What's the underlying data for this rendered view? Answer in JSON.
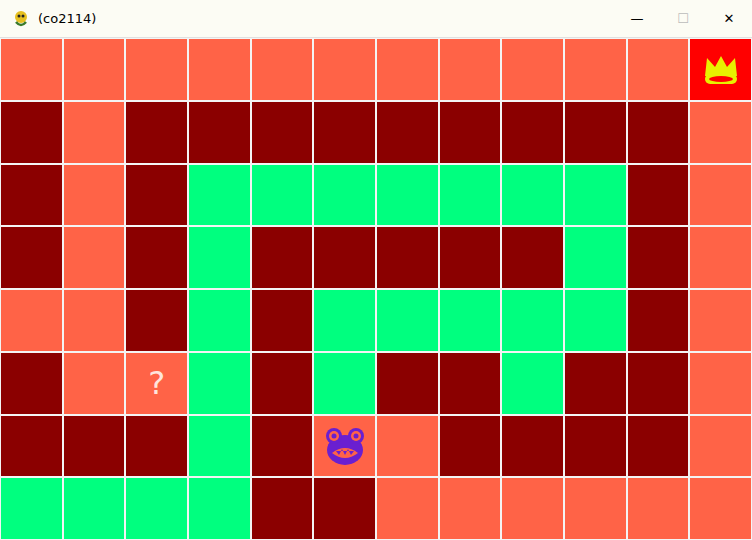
{
  "window": {
    "title": "(co2114)",
    "controls": [
      "—",
      "☐",
      "✕"
    ]
  },
  "grid": {
    "rows": [
      [
        {
          "kind": "plain",
          "color": "#ff6347"
        },
        {
          "kind": "plain",
          "color": "#ff6347"
        },
        {
          "kind": "plain",
          "color": "#ff6347"
        },
        {
          "kind": "plain",
          "color": "#ff6347"
        },
        {
          "kind": "plain",
          "color": "#ff6347"
        },
        {
          "kind": "plain",
          "color": "#ff6347"
        },
        {
          "kind": "plain",
          "color": "#ff6347"
        },
        {
          "kind": "plain",
          "color": "#ff6347"
        },
        {
          "kind": "plain",
          "color": "#ff6347"
        },
        {
          "kind": "plain",
          "color": "#ff6347"
        },
        {
          "kind": "plain",
          "color": "#ff6347"
        },
        {
          "kind": "crown",
          "color": "#ff0000"
        }
      ],
      [
        {
          "kind": "plain",
          "color": "#8b0000"
        },
        {
          "kind": "plain",
          "color": "#ff6347"
        },
        {
          "kind": "plain",
          "color": "#8b0000"
        },
        {
          "kind": "plain",
          "color": "#8b0000"
        },
        {
          "kind": "plain",
          "color": "#8b0000"
        },
        {
          "kind": "plain",
          "color": "#8b0000"
        },
        {
          "kind": "plain",
          "color": "#8b0000"
        },
        {
          "kind": "plain",
          "color": "#8b0000"
        },
        {
          "kind": "plain",
          "color": "#8b0000"
        },
        {
          "kind": "plain",
          "color": "#8b0000"
        },
        {
          "kind": "plain",
          "color": "#8b0000"
        },
        {
          "kind": "plain",
          "color": "#ff6347"
        }
      ],
      [
        {
          "kind": "plain",
          "color": "#8b0000"
        },
        {
          "kind": "plain",
          "color": "#ff6347"
        },
        {
          "kind": "plain",
          "color": "#8b0000"
        },
        {
          "kind": "plain",
          "color": "#00ff7f"
        },
        {
          "kind": "plain",
          "color": "#00ff7f"
        },
        {
          "kind": "plain",
          "color": "#00ff7f"
        },
        {
          "kind": "plain",
          "color": "#00ff7f"
        },
        {
          "kind": "plain",
          "color": "#00ff7f"
        },
        {
          "kind": "plain",
          "color": "#00ff7f"
        },
        {
          "kind": "plain",
          "color": "#00ff7f"
        },
        {
          "kind": "plain",
          "color": "#8b0000"
        },
        {
          "kind": "plain",
          "color": "#ff6347"
        }
      ],
      [
        {
          "kind": "plain",
          "color": "#8b0000"
        },
        {
          "kind": "plain",
          "color": "#ff6347"
        },
        {
          "kind": "plain",
          "color": "#8b0000"
        },
        {
          "kind": "plain",
          "color": "#00ff7f"
        },
        {
          "kind": "plain",
          "color": "#8b0000"
        },
        {
          "kind": "plain",
          "color": "#8b0000"
        },
        {
          "kind": "plain",
          "color": "#8b0000"
        },
        {
          "kind": "plain",
          "color": "#8b0000"
        },
        {
          "kind": "plain",
          "color": "#8b0000"
        },
        {
          "kind": "plain",
          "color": "#00ff7f"
        },
        {
          "kind": "plain",
          "color": "#8b0000"
        },
        {
          "kind": "plain",
          "color": "#ff6347"
        }
      ],
      [
        {
          "kind": "plain",
          "color": "#ff6347"
        },
        {
          "kind": "plain",
          "color": "#ff6347"
        },
        {
          "kind": "plain",
          "color": "#8b0000"
        },
        {
          "kind": "plain",
          "color": "#00ff7f"
        },
        {
          "kind": "plain",
          "color": "#8b0000"
        },
        {
          "kind": "plain",
          "color": "#00ff7f"
        },
        {
          "kind": "plain",
          "color": "#00ff7f"
        },
        {
          "kind": "plain",
          "color": "#00ff7f"
        },
        {
          "kind": "plain",
          "color": "#00ff7f"
        },
        {
          "kind": "plain",
          "color": "#00ff7f"
        },
        {
          "kind": "plain",
          "color": "#8b0000"
        },
        {
          "kind": "plain",
          "color": "#ff6347"
        }
      ],
      [
        {
          "kind": "plain",
          "color": "#8b0000"
        },
        {
          "kind": "plain",
          "color": "#ff6347"
        },
        {
          "kind": "label",
          "color": "#ff6347",
          "text": "?"
        },
        {
          "kind": "plain",
          "color": "#00ff7f"
        },
        {
          "kind": "plain",
          "color": "#8b0000"
        },
        {
          "kind": "plain",
          "color": "#00ff7f"
        },
        {
          "kind": "plain",
          "color": "#8b0000"
        },
        {
          "kind": "plain",
          "color": "#8b0000"
        },
        {
          "kind": "plain",
          "color": "#00ff7f"
        },
        {
          "kind": "plain",
          "color": "#8b0000"
        },
        {
          "kind": "plain",
          "color": "#8b0000"
        },
        {
          "kind": "plain",
          "color": "#ff6347"
        }
      ],
      [
        {
          "kind": "plain",
          "color": "#8b0000"
        },
        {
          "kind": "plain",
          "color": "#8b0000"
        },
        {
          "kind": "plain",
          "color": "#8b0000"
        },
        {
          "kind": "plain",
          "color": "#00ff7f"
        },
        {
          "kind": "plain",
          "color": "#8b0000"
        },
        {
          "kind": "monster",
          "color": "#ff6347"
        },
        {
          "kind": "plain",
          "color": "#ff6347"
        },
        {
          "kind": "plain",
          "color": "#8b0000"
        },
        {
          "kind": "plain",
          "color": "#8b0000"
        },
        {
          "kind": "plain",
          "color": "#8b0000"
        },
        {
          "kind": "plain",
          "color": "#8b0000"
        },
        {
          "kind": "plain",
          "color": "#ff6347"
        }
      ],
      [
        {
          "kind": "plain",
          "color": "#00ff7f"
        },
        {
          "kind": "plain",
          "color": "#00ff7f"
        },
        {
          "kind": "plain",
          "color": "#00ff7f"
        },
        {
          "kind": "plain",
          "color": "#00ff7f"
        },
        {
          "kind": "plain",
          "color": "#8b0000"
        },
        {
          "kind": "plain",
          "color": "#8b0000"
        },
        {
          "kind": "plain",
          "color": "#ff6347"
        },
        {
          "kind": "plain",
          "color": "#ff6347"
        },
        {
          "kind": "plain",
          "color": "#ff6347"
        },
        {
          "kind": "plain",
          "color": "#ff6347"
        },
        {
          "kind": "plain",
          "color": "#ff6347"
        },
        {
          "kind": "plain",
          "color": "#ff6347"
        }
      ]
    ]
  }
}
